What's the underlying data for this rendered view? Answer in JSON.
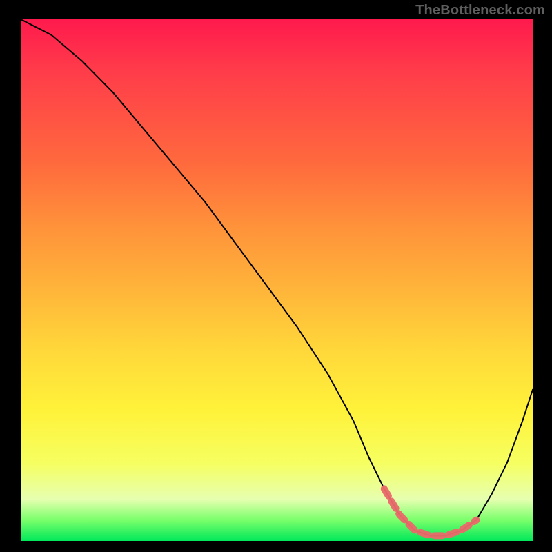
{
  "watermark": "TheBottleneck.com",
  "colors": {
    "background": "#000000",
    "gradient_stops": [
      "#ff1a4d",
      "#ff3c4a",
      "#ff6b3d",
      "#ff933a",
      "#ffb53a",
      "#ffd93a",
      "#fff23a",
      "#f6ff60",
      "#e6ffb0",
      "#7aff6b",
      "#00e85a"
    ],
    "curve": "#000000",
    "valley_marker": "#e96a6a",
    "watermark_text": "#5e5e5e"
  },
  "chart_data": {
    "type": "line",
    "title": "",
    "xlabel": "",
    "ylabel": "",
    "xlim": [
      0,
      100
    ],
    "ylim": [
      0,
      100
    ],
    "grid": false,
    "legend": false,
    "annotations": [
      "TheBottleneck.com"
    ],
    "series": [
      {
        "name": "bottleneck-curve",
        "x": [
          0,
          6,
          12,
          18,
          24,
          30,
          36,
          42,
          48,
          54,
          60,
          65,
          68,
          71,
          74,
          77,
          80,
          83,
          86,
          89,
          92,
          95,
          98,
          100
        ],
        "values": [
          100,
          97,
          92,
          86,
          79,
          72,
          65,
          57,
          49,
          41,
          32,
          23,
          16,
          10,
          5,
          2,
          1,
          1,
          2,
          4,
          9,
          15,
          23,
          29
        ]
      }
    ],
    "valley_marker": {
      "x_start": 69,
      "x_end": 90,
      "y_min": 1,
      "description": "dashed highlight over the near-zero trough of the curve"
    }
  }
}
